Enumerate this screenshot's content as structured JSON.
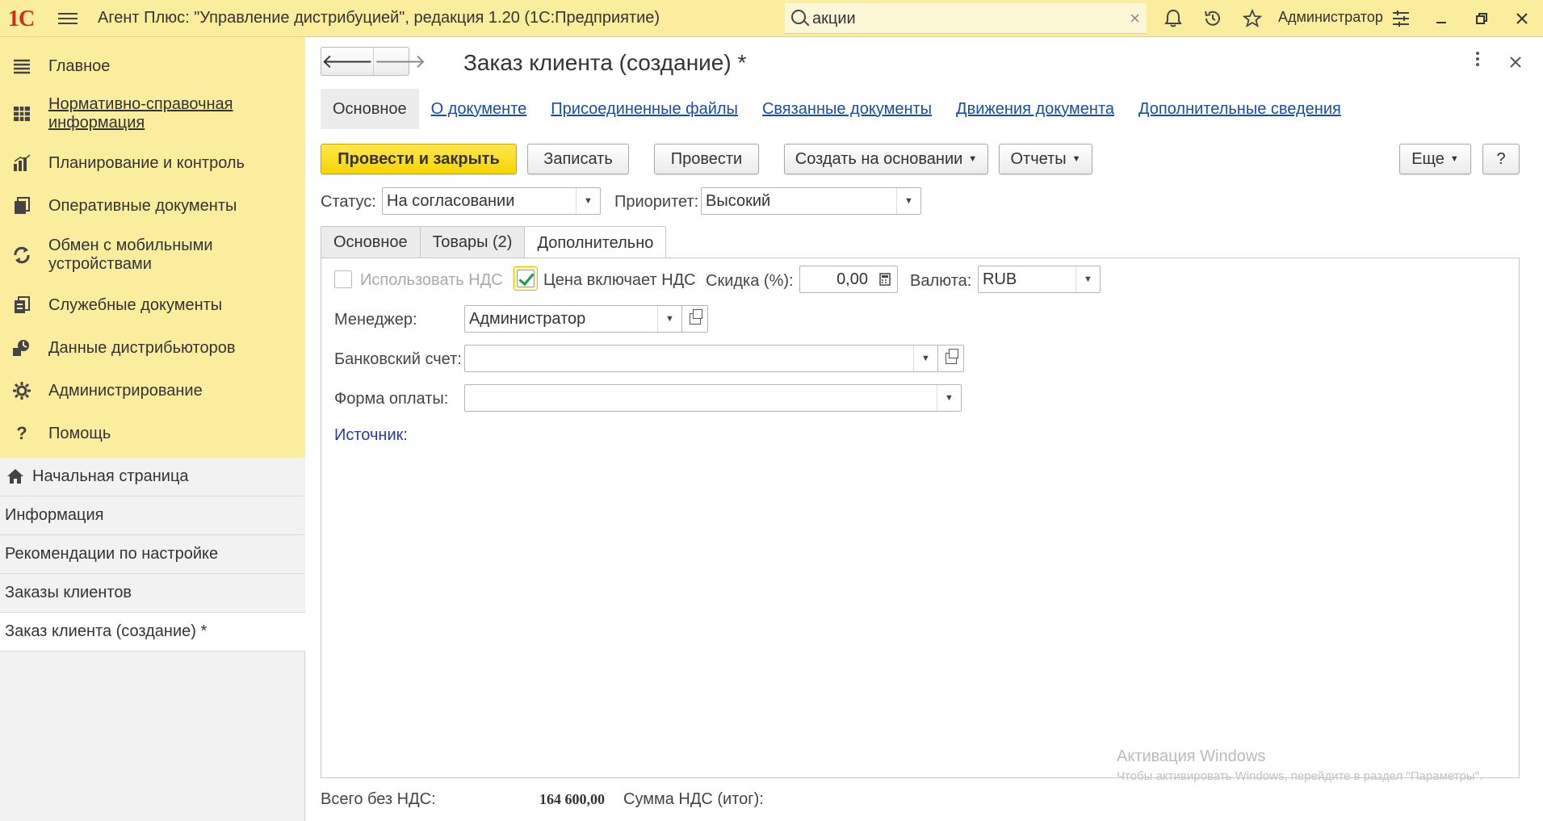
{
  "titlebar": {
    "logo": "1С",
    "title": "Агент Плюс: \"Управление дистрибуцией\", редакция 1.20  (1С:Предприятие)",
    "search_value": "акции",
    "user": "Администратор"
  },
  "sidebar": {
    "sections": [
      {
        "label": "Главное",
        "icon": "menu-lines-icon"
      },
      {
        "label": "Нормативно-справочная информация",
        "icon": "grid-table-icon"
      },
      {
        "label": "Планирование и контроль",
        "icon": "bar-chart-icon"
      },
      {
        "label": "Оперативные документы",
        "icon": "documents-icon"
      },
      {
        "label": "Обмен с мобильными устройствами",
        "icon": "sync-icon"
      },
      {
        "label": "Служебные документы",
        "icon": "service-docs-icon"
      },
      {
        "label": "Данные дистрибьюторов",
        "icon": "distributor-data-icon"
      },
      {
        "label": "Администрирование",
        "icon": "gear-icon"
      },
      {
        "label": "Помощь",
        "icon": "question-icon"
      }
    ],
    "open_windows": [
      {
        "label": "Начальная страница"
      },
      {
        "label": "Информация"
      },
      {
        "label": "Рекомендации по настройке"
      },
      {
        "label": "Заказы клиентов"
      },
      {
        "label": "Заказ клиента (создание) *"
      }
    ]
  },
  "form": {
    "title": "Заказ клиента (создание) *",
    "top_tabs": [
      "Основное",
      "О документе",
      "Присоединенные файлы",
      "Связанные документы",
      "Движения документа",
      "Дополнительные сведения"
    ],
    "buttons": {
      "post_close": "Провести и закрыть",
      "save": "Записать",
      "post": "Провести",
      "create_based": "Создать на основании",
      "reports": "Отчеты",
      "more": "Еще",
      "help": "?"
    },
    "status_label": "Статус:",
    "status_value": "На согласовании",
    "priority_label": "Приоритет:",
    "priority_value": "Высокий",
    "inner_tabs": [
      "Основное",
      "Товары (2)",
      "Дополнительно"
    ],
    "use_vat_label": "Использовать НДС",
    "use_vat_checked": false,
    "price_incl_vat_label": "Цена включает НДС",
    "price_incl_vat_checked": true,
    "discount_label": "Скидка (%):",
    "discount_value": "0,00",
    "currency_label": "Валюта:",
    "currency_value": "RUB",
    "manager_label": "Менеджер:",
    "manager_value": "Администратор",
    "bank_label": "Банковский счет:",
    "bank_value": "",
    "payment_label": "Форма оплаты:",
    "payment_value": "",
    "source_label": "Источник:",
    "total_no_vat_label": "Всего без НДС:",
    "total_no_vat_value": "164 600,00",
    "vat_total_label": "Сумма НДС (итог):"
  },
  "watermark": {
    "line1": "Активация Windows",
    "line2": "Чтобы активировать Windows, перейдите в раздел \"Параметры\"."
  },
  "colors": {
    "titlebar_bg": "#fbed9e",
    "primary_button": "#f6d500",
    "link": "#1a4e9d",
    "checkmark": "#1a9e3e"
  }
}
